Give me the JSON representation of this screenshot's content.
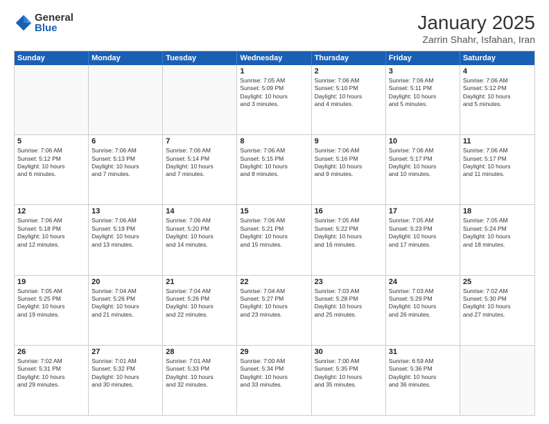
{
  "logo": {
    "general": "General",
    "blue": "Blue"
  },
  "title": "January 2025",
  "subtitle": "Zarrin Shahr, Isfahan, Iran",
  "header_days": [
    "Sunday",
    "Monday",
    "Tuesday",
    "Wednesday",
    "Thursday",
    "Friday",
    "Saturday"
  ],
  "weeks": [
    [
      {
        "day": "",
        "lines": []
      },
      {
        "day": "",
        "lines": []
      },
      {
        "day": "",
        "lines": []
      },
      {
        "day": "1",
        "lines": [
          "Sunrise: 7:05 AM",
          "Sunset: 5:09 PM",
          "Daylight: 10 hours",
          "and 3 minutes."
        ]
      },
      {
        "day": "2",
        "lines": [
          "Sunrise: 7:06 AM",
          "Sunset: 5:10 PM",
          "Daylight: 10 hours",
          "and 4 minutes."
        ]
      },
      {
        "day": "3",
        "lines": [
          "Sunrise: 7:06 AM",
          "Sunset: 5:11 PM",
          "Daylight: 10 hours",
          "and 5 minutes."
        ]
      },
      {
        "day": "4",
        "lines": [
          "Sunrise: 7:06 AM",
          "Sunset: 5:12 PM",
          "Daylight: 10 hours",
          "and 5 minutes."
        ]
      }
    ],
    [
      {
        "day": "5",
        "lines": [
          "Sunrise: 7:06 AM",
          "Sunset: 5:12 PM",
          "Daylight: 10 hours",
          "and 6 minutes."
        ]
      },
      {
        "day": "6",
        "lines": [
          "Sunrise: 7:06 AM",
          "Sunset: 5:13 PM",
          "Daylight: 10 hours",
          "and 7 minutes."
        ]
      },
      {
        "day": "7",
        "lines": [
          "Sunrise: 7:06 AM",
          "Sunset: 5:14 PM",
          "Daylight: 10 hours",
          "and 7 minutes."
        ]
      },
      {
        "day": "8",
        "lines": [
          "Sunrise: 7:06 AM",
          "Sunset: 5:15 PM",
          "Daylight: 10 hours",
          "and 8 minutes."
        ]
      },
      {
        "day": "9",
        "lines": [
          "Sunrise: 7:06 AM",
          "Sunset: 5:16 PM",
          "Daylight: 10 hours",
          "and 9 minutes."
        ]
      },
      {
        "day": "10",
        "lines": [
          "Sunrise: 7:06 AM",
          "Sunset: 5:17 PM",
          "Daylight: 10 hours",
          "and 10 minutes."
        ]
      },
      {
        "day": "11",
        "lines": [
          "Sunrise: 7:06 AM",
          "Sunset: 5:17 PM",
          "Daylight: 10 hours",
          "and 11 minutes."
        ]
      }
    ],
    [
      {
        "day": "12",
        "lines": [
          "Sunrise: 7:06 AM",
          "Sunset: 5:18 PM",
          "Daylight: 10 hours",
          "and 12 minutes."
        ]
      },
      {
        "day": "13",
        "lines": [
          "Sunrise: 7:06 AM",
          "Sunset: 5:19 PM",
          "Daylight: 10 hours",
          "and 13 minutes."
        ]
      },
      {
        "day": "14",
        "lines": [
          "Sunrise: 7:06 AM",
          "Sunset: 5:20 PM",
          "Daylight: 10 hours",
          "and 14 minutes."
        ]
      },
      {
        "day": "15",
        "lines": [
          "Sunrise: 7:06 AM",
          "Sunset: 5:21 PM",
          "Daylight: 10 hours",
          "and 15 minutes."
        ]
      },
      {
        "day": "16",
        "lines": [
          "Sunrise: 7:05 AM",
          "Sunset: 5:22 PM",
          "Daylight: 10 hours",
          "and 16 minutes."
        ]
      },
      {
        "day": "17",
        "lines": [
          "Sunrise: 7:05 AM",
          "Sunset: 5:23 PM",
          "Daylight: 10 hours",
          "and 17 minutes."
        ]
      },
      {
        "day": "18",
        "lines": [
          "Sunrise: 7:05 AM",
          "Sunset: 5:24 PM",
          "Daylight: 10 hours",
          "and 18 minutes."
        ]
      }
    ],
    [
      {
        "day": "19",
        "lines": [
          "Sunrise: 7:05 AM",
          "Sunset: 5:25 PM",
          "Daylight: 10 hours",
          "and 19 minutes."
        ]
      },
      {
        "day": "20",
        "lines": [
          "Sunrise: 7:04 AM",
          "Sunset: 5:26 PM",
          "Daylight: 10 hours",
          "and 21 minutes."
        ]
      },
      {
        "day": "21",
        "lines": [
          "Sunrise: 7:04 AM",
          "Sunset: 5:26 PM",
          "Daylight: 10 hours",
          "and 22 minutes."
        ]
      },
      {
        "day": "22",
        "lines": [
          "Sunrise: 7:04 AM",
          "Sunset: 5:27 PM",
          "Daylight: 10 hours",
          "and 23 minutes."
        ]
      },
      {
        "day": "23",
        "lines": [
          "Sunrise: 7:03 AM",
          "Sunset: 5:28 PM",
          "Daylight: 10 hours",
          "and 25 minutes."
        ]
      },
      {
        "day": "24",
        "lines": [
          "Sunrise: 7:03 AM",
          "Sunset: 5:29 PM",
          "Daylight: 10 hours",
          "and 26 minutes."
        ]
      },
      {
        "day": "25",
        "lines": [
          "Sunrise: 7:02 AM",
          "Sunset: 5:30 PM",
          "Daylight: 10 hours",
          "and 27 minutes."
        ]
      }
    ],
    [
      {
        "day": "26",
        "lines": [
          "Sunrise: 7:02 AM",
          "Sunset: 5:31 PM",
          "Daylight: 10 hours",
          "and 29 minutes."
        ]
      },
      {
        "day": "27",
        "lines": [
          "Sunrise: 7:01 AM",
          "Sunset: 5:32 PM",
          "Daylight: 10 hours",
          "and 30 minutes."
        ]
      },
      {
        "day": "28",
        "lines": [
          "Sunrise: 7:01 AM",
          "Sunset: 5:33 PM",
          "Daylight: 10 hours",
          "and 32 minutes."
        ]
      },
      {
        "day": "29",
        "lines": [
          "Sunrise: 7:00 AM",
          "Sunset: 5:34 PM",
          "Daylight: 10 hours",
          "and 33 minutes."
        ]
      },
      {
        "day": "30",
        "lines": [
          "Sunrise: 7:00 AM",
          "Sunset: 5:35 PM",
          "Daylight: 10 hours",
          "and 35 minutes."
        ]
      },
      {
        "day": "31",
        "lines": [
          "Sunrise: 6:59 AM",
          "Sunset: 5:36 PM",
          "Daylight: 10 hours",
          "and 36 minutes."
        ]
      },
      {
        "day": "",
        "lines": []
      }
    ]
  ]
}
